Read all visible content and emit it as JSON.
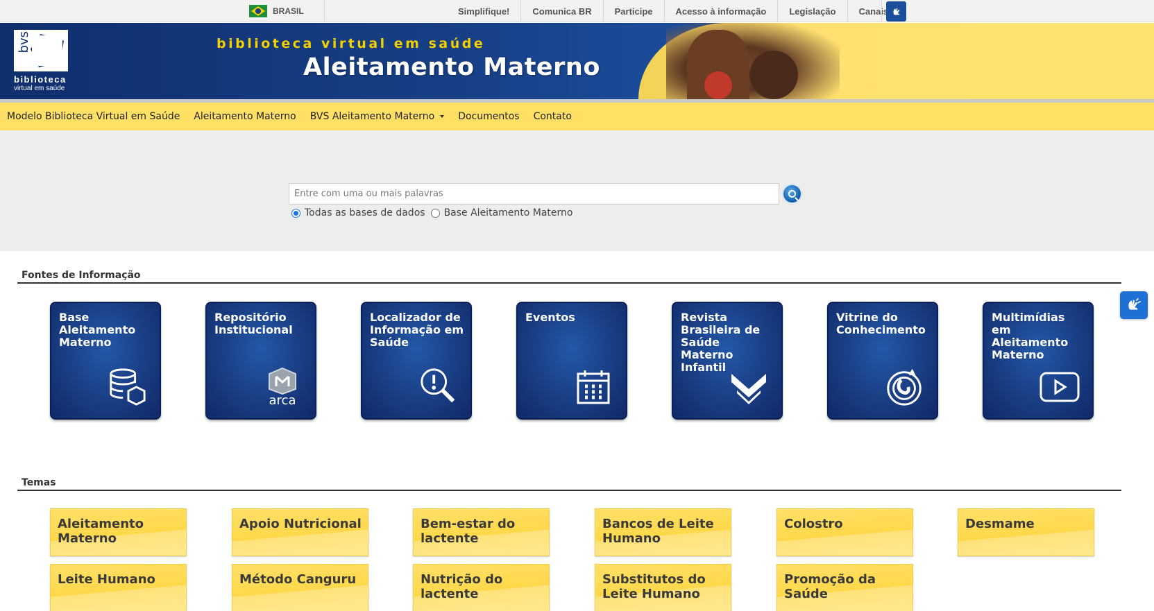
{
  "govbar": {
    "country": "BRASIL",
    "links": [
      {
        "label": "Simplifique!"
      },
      {
        "label": "Comunica BR"
      },
      {
        "label": "Participe"
      },
      {
        "label": "Acesso à informação"
      },
      {
        "label": "Legislação"
      },
      {
        "label": "Canais"
      }
    ],
    "libras_icon": "sign-language-icon"
  },
  "header": {
    "logo_letters": "bvs",
    "logo_line1": "biblioteca",
    "logo_line2": "virtual em saúde",
    "kicker": "biblioteca virtual em saúde",
    "title": "Aleitamento Materno"
  },
  "nav": {
    "items": [
      {
        "label": "Modelo Biblioteca Virtual em Saúde"
      },
      {
        "label": "Aleitamento Materno"
      },
      {
        "label": "BVS Aleitamento Materno"
      },
      {
        "label": "Documentos"
      },
      {
        "label": "Contato"
      }
    ]
  },
  "search": {
    "placeholder": "Entre com uma ou mais palavras",
    "value": "",
    "options": [
      {
        "label": "Todas as bases de dados",
        "selected": true
      },
      {
        "label": "Base Aleitamento Materno",
        "selected": false
      }
    ]
  },
  "sources": {
    "title": "Fontes de Informação",
    "items": [
      {
        "label": "Base Aleitamento Materno",
        "icon": "database-icon"
      },
      {
        "label": "Repositório Institucional",
        "icon": "arca-icon",
        "icon_text": "arca"
      },
      {
        "label": "Localizador de Informação em Saúde",
        "icon": "magnifier-icon"
      },
      {
        "label": "Eventos",
        "icon": "calendar-icon"
      },
      {
        "label": "Revista Brasileira de Saúde Materno Infantil",
        "icon": "chevrons-icon"
      },
      {
        "label": "Vitrine do Conhecimento",
        "icon": "vitrine-icon"
      },
      {
        "label": "Multimídias em Aleitamento Materno",
        "icon": "play-icon"
      }
    ]
  },
  "temas": {
    "title": "Temas",
    "items": [
      {
        "label": "Aleitamento Materno"
      },
      {
        "label": "Apoio Nutricional"
      },
      {
        "label": "Bem-estar do lactente"
      },
      {
        "label": "Bancos de Leite Humano"
      },
      {
        "label": "Colostro"
      },
      {
        "label": "Desmame"
      },
      {
        "label": "Leite Humano"
      },
      {
        "label": "Método Canguru"
      },
      {
        "label": "Nutrição do lactente"
      },
      {
        "label": "Substitutos do Leite Humano"
      },
      {
        "label": "Promoção da Saúde"
      }
    ]
  },
  "colors": {
    "header_blue": "#173f86",
    "nav_yellow": "#ffe064",
    "card_blue": "#1a3f85",
    "tema_yellow": "#ffd84a"
  }
}
